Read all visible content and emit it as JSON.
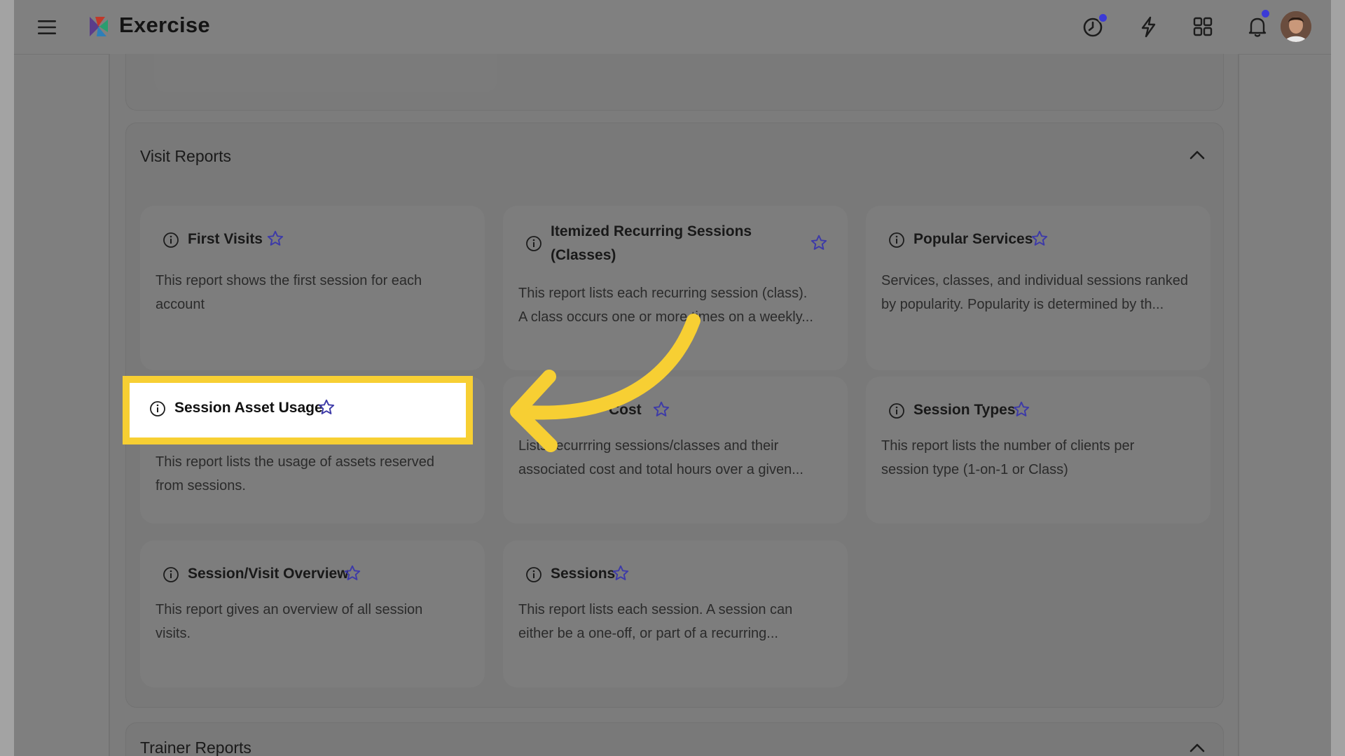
{
  "app": {
    "title": "Exercise"
  },
  "icons": {
    "menu": "hamburger-icon",
    "history": "clock-icon",
    "quick": "lightning-icon",
    "apps": "grid-icon",
    "notifications": "bell-icon",
    "info": "info-icon",
    "favorite": "star-outline-icon",
    "collapse": "chevron-up-icon"
  },
  "colors": {
    "accent": "#3b3ad6",
    "star": "#3d3aa8",
    "highlight": "#f7cf33",
    "overlay": "#808080"
  },
  "visit_reports": {
    "title": "Visit Reports",
    "cards": [
      {
        "title": "First Visits",
        "description_line1": "This report shows the first session for each",
        "description_line2": "account"
      },
      {
        "title_line1": "Itemized Recurring Sessions",
        "title_line2": "(Classes)",
        "description_line1": "This report lists each recurring session (class).",
        "description_line2": "A class occurs one or more times on a weekly..."
      },
      {
        "title": "Popular Services",
        "description_line1": "Services, classes, and individual sessions ranked",
        "description_line2": "by popularity. Popularity is determined by th..."
      },
      {
        "title": "Session Asset Usage",
        "description_line1": "This report lists the usage of assets reserved",
        "description_line2": "from sessions."
      },
      {
        "title": "Cost",
        "description_line1": "Lists recurrring sessions/classes and their",
        "description_line2": "associated cost and total hours over a given..."
      },
      {
        "title": "Session Types",
        "description_line1": "This report lists the number of clients per",
        "description_line2": "session type (1-on-1 or Class)"
      },
      {
        "title": "Session/Visit Overview",
        "description_line1": "This report gives an overview of all session",
        "description_line2": "visits."
      },
      {
        "title": "Sessions",
        "description_line1": "This report lists each session. A session can",
        "description_line2": "either be a one-off, or part of a recurring..."
      }
    ]
  },
  "trainer_reports": {
    "title": "Trainer Reports"
  }
}
